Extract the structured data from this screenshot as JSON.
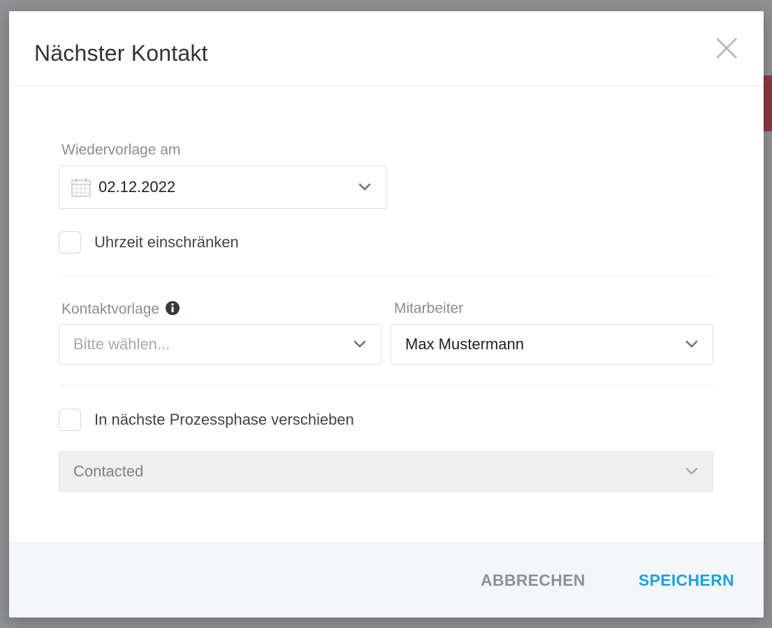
{
  "dialog": {
    "title": "Nächster Kontakt"
  },
  "follow_up": {
    "label": "Wiedervorlage am",
    "date_value": "02.12.2022"
  },
  "restrict_time": {
    "label": "Uhrzeit einschränken",
    "checked": false
  },
  "contact_template": {
    "label": "Kontaktvorlage",
    "placeholder": "Bitte wählen..."
  },
  "employee": {
    "label": "Mitarbeiter",
    "value": "Max Mustermann"
  },
  "move_phase": {
    "label": "In nächste Prozessphase verschieben",
    "checked": false
  },
  "process_phase": {
    "value": "Contacted",
    "disabled": true
  },
  "footer": {
    "cancel_label": "ABBRECHEN",
    "save_label": "SPEICHERN"
  },
  "colors": {
    "accent": "#1aa3dd",
    "cancel": "#8e9194",
    "overlay": "#8e8f91"
  },
  "icons": {
    "close": "close-icon",
    "calendar": "calendar-icon",
    "dropdown": "chevron-down-icon",
    "info": "info-icon"
  }
}
